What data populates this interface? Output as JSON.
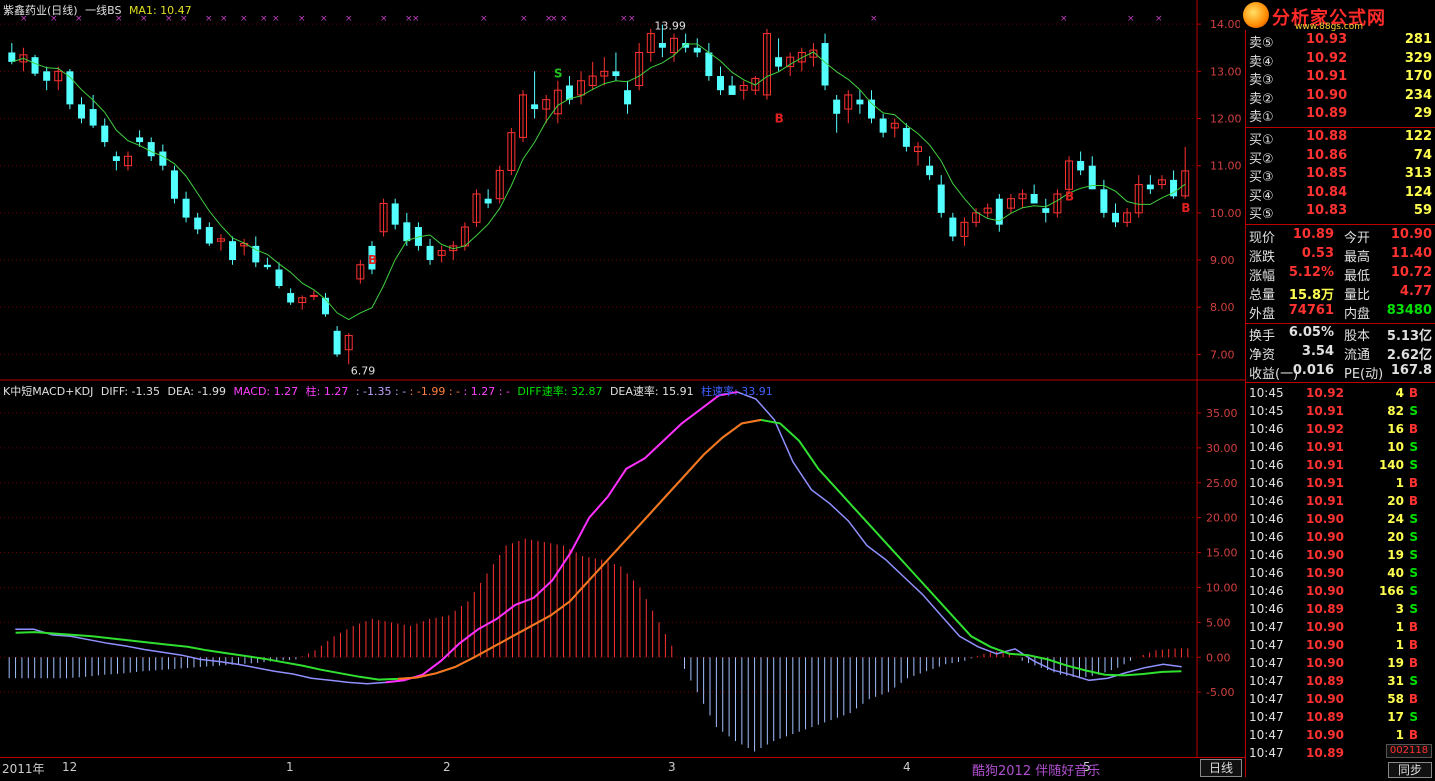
{
  "title_bar": {
    "stock_name": "紫鑫药业(日线)",
    "indicator": "一线BS",
    "ma_label": "MA1: 10.47"
  },
  "price_axis": [
    "14.00",
    "13.00",
    "12.00",
    "11.00",
    "10.00",
    "9.00",
    "8.00",
    "7.00"
  ],
  "price_annotations": {
    "high": "13.99",
    "low": "6.79"
  },
  "signals": {
    "buy": "B",
    "sell": "S"
  },
  "macd_legend": {
    "name": "K中短MACD+KDJ",
    "diff": "DIFF: -1.35",
    "dea": "DEA: -1.99",
    "macd": "MACD: 1.27",
    "zhu": "柱: 1.27",
    "v1": ": -1.35",
    "v2": ": -",
    "v3": ": -1.99",
    "v4": ": -",
    "v5": ": 1.27",
    "v6": ": -",
    "diff_speed": "DIFF速率: 32.87",
    "dea_speed": "DEA速率: 15.91",
    "zhu_speed": "柱速率: 33.91"
  },
  "macd_axis": [
    "35.00",
    "30.00",
    "25.00",
    "20.00",
    "15.00",
    "10.00",
    "5.00",
    "0.00",
    "-5.00"
  ],
  "date_axis": [
    "2011年",
    "12",
    "1",
    "2",
    "3",
    "4",
    "5"
  ],
  "period_tab": "日线",
  "watermark": "酷狗2012 伴随好音乐",
  "logo": {
    "name": "分析家公式网",
    "url": "www.88gs.com"
  },
  "order_book": {
    "sells": [
      {
        "label": "卖⑤",
        "price": "10.93",
        "vol": "281"
      },
      {
        "label": "卖④",
        "price": "10.92",
        "vol": "329"
      },
      {
        "label": "卖③",
        "price": "10.91",
        "vol": "170"
      },
      {
        "label": "卖②",
        "price": "10.90",
        "vol": "234"
      },
      {
        "label": "卖①",
        "price": "10.89",
        "vol": "29"
      }
    ],
    "buys": [
      {
        "label": "买①",
        "price": "10.88",
        "vol": "122"
      },
      {
        "label": "买②",
        "price": "10.86",
        "vol": "74"
      },
      {
        "label": "买③",
        "price": "10.85",
        "vol": "313"
      },
      {
        "label": "买④",
        "price": "10.84",
        "vol": "124"
      },
      {
        "label": "买⑤",
        "price": "10.83",
        "vol": "59"
      }
    ]
  },
  "quote": {
    "xianjia_l": "现价",
    "xianjia": "10.89",
    "jinkai_l": "今开",
    "jinkai": "10.90",
    "zhangdie_l": "涨跌",
    "zhangdie": "0.53",
    "zuigao_l": "最高",
    "zuigao": "11.40",
    "zhangfu_l": "涨幅",
    "zhangfu": "5.12%",
    "zuidi_l": "最低",
    "zuidi": "10.72",
    "zongliang_l": "总量",
    "zongliang": "15.8万",
    "liangbi_l": "量比",
    "liangbi": "4.77",
    "waipan_l": "外盘",
    "waipan": "74761",
    "neipan_l": "内盘",
    "neipan": "83480",
    "huanshou_l": "换手",
    "huanshou": "6.05%",
    "guben_l": "股本",
    "guben": "5.13亿",
    "jingzi_l": "净资",
    "jingzi": "3.54",
    "liutong_l": "流通",
    "liutong": "2.62亿",
    "shouyi_l": "收益(一)",
    "shouyi": "0.016",
    "pe_l": "PE(动)",
    "pe": "167.8"
  },
  "ticks": [
    {
      "time": "10:45",
      "price": "10.92",
      "vol": "4",
      "side": "B"
    },
    {
      "time": "10:45",
      "price": "10.91",
      "vol": "82",
      "side": "S"
    },
    {
      "time": "10:46",
      "price": "10.92",
      "vol": "16",
      "side": "B"
    },
    {
      "time": "10:46",
      "price": "10.91",
      "vol": "10",
      "side": "S"
    },
    {
      "time": "10:46",
      "price": "10.91",
      "vol": "140",
      "side": "S"
    },
    {
      "time": "10:46",
      "price": "10.91",
      "vol": "1",
      "side": "B"
    },
    {
      "time": "10:46",
      "price": "10.91",
      "vol": "20",
      "side": "B"
    },
    {
      "time": "10:46",
      "price": "10.90",
      "vol": "24",
      "side": "S"
    },
    {
      "time": "10:46",
      "price": "10.90",
      "vol": "20",
      "side": "S"
    },
    {
      "time": "10:46",
      "price": "10.90",
      "vol": "19",
      "side": "S"
    },
    {
      "time": "10:46",
      "price": "10.90",
      "vol": "40",
      "side": "S"
    },
    {
      "time": "10:46",
      "price": "10.90",
      "vol": "166",
      "side": "S"
    },
    {
      "time": "10:46",
      "price": "10.89",
      "vol": "3",
      "side": "S"
    },
    {
      "time": "10:47",
      "price": "10.90",
      "vol": "1",
      "side": "B"
    },
    {
      "time": "10:47",
      "price": "10.90",
      "vol": "1",
      "side": "B"
    },
    {
      "time": "10:47",
      "price": "10.90",
      "vol": "19",
      "side": "B"
    },
    {
      "time": "10:47",
      "price": "10.89",
      "vol": "31",
      "side": "S"
    },
    {
      "time": "10:47",
      "price": "10.90",
      "vol": "58",
      "side": "B"
    },
    {
      "time": "10:47",
      "price": "10.89",
      "vol": "17",
      "side": "S"
    },
    {
      "time": "10:47",
      "price": "10.90",
      "vol": "1",
      "side": "B"
    },
    {
      "time": "10:47",
      "price": "10.89",
      "vol": "",
      "side": ""
    }
  ],
  "tick_id": "002118",
  "sync_button": "同步",
  "chart_data": [
    {
      "type": "candlestick",
      "title": "紫鑫药业(日线)",
      "ylim": [
        6.5,
        14.3
      ],
      "series": [
        {
          "name": "MA1"
        }
      ],
      "signals": [
        {
          "label": "S",
          "price": 12.95
        },
        {
          "label": "B",
          "price": 9.0
        },
        {
          "label": "B",
          "price": 12.0
        },
        {
          "label": "B",
          "price": 10.35
        },
        {
          "label": "B",
          "price": 10.1
        }
      ],
      "ohlc": [
        [
          13.4,
          13.6,
          13.15,
          13.2
        ],
        [
          13.2,
          13.5,
          13.0,
          13.35
        ],
        [
          13.3,
          13.35,
          12.9,
          12.95
        ],
        [
          13.0,
          13.1,
          12.6,
          12.8
        ],
        [
          12.8,
          13.1,
          12.6,
          13.0
        ],
        [
          13.0,
          13.05,
          12.2,
          12.3
        ],
        [
          12.3,
          12.45,
          11.9,
          12.0
        ],
        [
          12.2,
          12.5,
          11.8,
          11.85
        ],
        [
          11.85,
          12.0,
          11.4,
          11.5
        ],
        [
          11.2,
          11.3,
          10.9,
          11.1
        ],
        [
          11.0,
          11.3,
          10.9,
          11.2
        ],
        [
          11.6,
          11.75,
          11.4,
          11.5
        ],
        [
          11.5,
          11.6,
          11.1,
          11.2
        ],
        [
          11.3,
          11.45,
          10.9,
          11.0
        ],
        [
          10.9,
          11.0,
          10.2,
          10.3
        ],
        [
          10.3,
          10.45,
          9.8,
          9.9
        ],
        [
          9.9,
          10.0,
          9.55,
          9.65
        ],
        [
          9.7,
          9.8,
          9.3,
          9.35
        ],
        [
          9.4,
          9.55,
          9.2,
          9.45
        ],
        [
          9.4,
          9.5,
          8.9,
          9.0
        ],
        [
          9.3,
          9.45,
          9.1,
          9.35
        ],
        [
          9.3,
          9.5,
          8.85,
          8.95
        ],
        [
          8.9,
          9.05,
          8.8,
          8.85
        ],
        [
          8.8,
          8.95,
          8.4,
          8.45
        ],
        [
          8.3,
          8.4,
          8.05,
          8.1
        ],
        [
          8.1,
          8.25,
          7.95,
          8.2
        ],
        [
          8.25,
          8.35,
          8.15,
          8.25
        ],
        [
          8.2,
          8.3,
          7.8,
          7.85
        ],
        [
          7.5,
          7.6,
          6.95,
          7.0
        ],
        [
          7.1,
          7.45,
          6.79,
          7.4
        ],
        [
          8.6,
          9.0,
          8.5,
          8.9
        ],
        [
          9.3,
          9.4,
          8.7,
          8.8
        ],
        [
          9.6,
          10.3,
          9.5,
          10.2
        ],
        [
          10.2,
          10.3,
          9.65,
          9.75
        ],
        [
          9.8,
          10.0,
          9.3,
          9.4
        ],
        [
          9.7,
          9.8,
          9.2,
          9.3
        ],
        [
          9.3,
          9.45,
          8.9,
          9.0
        ],
        [
          9.1,
          9.3,
          8.95,
          9.2
        ],
        [
          9.2,
          9.4,
          9.0,
          9.3
        ],
        [
          9.3,
          9.8,
          9.2,
          9.7
        ],
        [
          9.8,
          10.5,
          9.7,
          10.4
        ],
        [
          10.3,
          10.5,
          10.1,
          10.2
        ],
        [
          10.3,
          11.0,
          10.2,
          10.9
        ],
        [
          10.9,
          11.8,
          10.8,
          11.7
        ],
        [
          11.6,
          12.6,
          11.5,
          12.5
        ],
        [
          12.3,
          13.0,
          12.0,
          12.2
        ],
        [
          12.2,
          12.5,
          11.9,
          12.4
        ],
        [
          12.1,
          12.8,
          11.9,
          12.6
        ],
        [
          12.7,
          12.9,
          12.3,
          12.4
        ],
        [
          12.5,
          13.0,
          12.3,
          12.8
        ],
        [
          12.7,
          13.2,
          12.6,
          12.9
        ],
        [
          12.9,
          13.3,
          12.7,
          13.0
        ],
        [
          13.0,
          13.4,
          12.8,
          12.9
        ],
        [
          12.6,
          12.8,
          12.1,
          12.3
        ],
        [
          12.7,
          13.6,
          12.6,
          13.4
        ],
        [
          13.4,
          13.9,
          13.2,
          13.8
        ],
        [
          13.6,
          13.99,
          13.3,
          13.5
        ],
        [
          13.4,
          13.8,
          13.2,
          13.7
        ],
        [
          13.6,
          13.8,
          13.4,
          13.5
        ],
        [
          13.5,
          13.7,
          13.3,
          13.4
        ],
        [
          13.4,
          13.6,
          12.8,
          12.9
        ],
        [
          12.9,
          13.1,
          12.5,
          12.6
        ],
        [
          12.7,
          12.9,
          12.5,
          12.5
        ],
        [
          12.6,
          12.8,
          12.4,
          12.7
        ],
        [
          12.6,
          12.9,
          12.5,
          12.85
        ],
        [
          12.5,
          13.9,
          12.4,
          13.8
        ],
        [
          13.3,
          13.7,
          13.0,
          13.1
        ],
        [
          13.1,
          13.4,
          12.9,
          13.3
        ],
        [
          13.2,
          13.5,
          13.0,
          13.4
        ],
        [
          13.3,
          13.6,
          13.1,
          13.45
        ],
        [
          13.6,
          13.8,
          12.6,
          12.7
        ],
        [
          12.4,
          12.5,
          11.7,
          12.1
        ],
        [
          12.2,
          12.6,
          11.9,
          12.5
        ],
        [
          12.4,
          12.6,
          12.1,
          12.3
        ],
        [
          12.4,
          12.6,
          11.9,
          12.0
        ],
        [
          12.0,
          12.1,
          11.6,
          11.7
        ],
        [
          11.8,
          12.0,
          11.6,
          11.9
        ],
        [
          11.8,
          11.9,
          11.3,
          11.4
        ],
        [
          11.3,
          11.5,
          11.0,
          11.4
        ],
        [
          11.0,
          11.2,
          10.7,
          10.8
        ],
        [
          10.6,
          10.8,
          9.9,
          10.0
        ],
        [
          9.9,
          10.0,
          9.4,
          9.5
        ],
        [
          9.5,
          9.9,
          9.3,
          9.8
        ],
        [
          9.8,
          10.1,
          9.7,
          10.0
        ],
        [
          10.0,
          10.2,
          9.9,
          10.1
        ],
        [
          10.3,
          10.4,
          9.6,
          9.75
        ],
        [
          10.1,
          10.4,
          10.0,
          10.3
        ],
        [
          10.3,
          10.5,
          10.1,
          10.4
        ],
        [
          10.4,
          10.6,
          10.2,
          10.2
        ],
        [
          10.1,
          10.3,
          9.8,
          10.0
        ],
        [
          10.0,
          10.5,
          9.9,
          10.4
        ],
        [
          10.5,
          11.2,
          10.4,
          11.1
        ],
        [
          11.1,
          11.3,
          10.8,
          10.9
        ],
        [
          11.0,
          11.2,
          10.5,
          10.5
        ],
        [
          10.5,
          10.7,
          9.9,
          10.0
        ],
        [
          10.0,
          10.2,
          9.7,
          9.8
        ],
        [
          9.8,
          10.1,
          9.7,
          10.0
        ],
        [
          10.0,
          10.8,
          9.9,
          10.6
        ],
        [
          10.6,
          10.8,
          10.4,
          10.5
        ],
        [
          10.6,
          10.8,
          10.5,
          10.7
        ],
        [
          10.7,
          10.9,
          10.3,
          10.35
        ],
        [
          10.36,
          11.4,
          10.3,
          10.89
        ]
      ]
    },
    {
      "type": "line",
      "title": "K中短MACD+KDJ",
      "ylim": [
        -14,
        38
      ],
      "series": [
        {
          "name": "DIFF",
          "values": [
            4,
            4,
            3.2,
            3,
            2.5,
            2,
            1.6,
            1.1,
            0.7,
            0.3,
            -0.3,
            -0.6,
            -1.0,
            -1.5,
            -2.0,
            -2.4,
            -3.0,
            -3.3,
            -3.6,
            -3.8,
            -3.6,
            -3.3,
            -2.5,
            -0.5,
            2,
            4,
            5.5,
            7.5,
            8.5,
            11,
            15,
            20,
            23,
            27,
            28.5,
            31,
            33.5,
            35.5,
            37.5,
            38,
            37,
            34,
            28,
            24,
            22,
            19.5,
            16,
            14,
            11.5,
            9,
            6,
            3,
            1.5,
            0.5,
            1.2,
            -0.5,
            -1.8,
            -2.5,
            -3.3,
            -3.0,
            -2.2,
            -1.5,
            -1.0,
            -1.35
          ]
        },
        {
          "name": "DEA",
          "values": [
            3.5,
            3.6,
            3.4,
            3.2,
            3,
            2.7,
            2.4,
            2.1,
            1.8,
            1.5,
            1.0,
            0.6,
            0.2,
            -0.2,
            -0.7,
            -1.2,
            -1.8,
            -2.3,
            -2.8,
            -3.2,
            -3.1,
            -2.9,
            -2.3,
            -1.4,
            0,
            1.5,
            3,
            4.5,
            6,
            8,
            11,
            14,
            17,
            20,
            23,
            26,
            29,
            31.5,
            33.5,
            34,
            33.5,
            31,
            27,
            24,
            21,
            18,
            15,
            12,
            9,
            6,
            3,
            1.5,
            0.5,
            0.3,
            -0.3,
            -1.2,
            -1.9,
            -2.5,
            -2.6,
            -2.4,
            -2.1,
            -1.99
          ]
        },
        {
          "name": "MACD",
          "values": [
            -3,
            -3,
            -3,
            -3,
            -2.8,
            -2.5,
            -2.3,
            -2.0,
            -1.8,
            -1.6,
            -1.4,
            -1.2,
            -1.0,
            -0.8,
            -0.5,
            -0.3,
            1,
            3,
            4.5,
            5.5,
            5,
            4.5,
            5.5,
            6,
            8,
            12,
            16,
            17,
            16.5,
            16,
            14.5,
            14,
            13,
            10,
            5,
            0,
            -5,
            -10,
            -12,
            -13.5,
            -12,
            -11,
            -10,
            -9,
            -8,
            -6,
            -5,
            -3,
            -2,
            -1,
            -0.5,
            0.5,
            1,
            -0.5,
            -1.5,
            -2.5,
            -3,
            -2.5,
            -1.5,
            0,
            1,
            1.27
          ]
        }
      ]
    }
  ]
}
